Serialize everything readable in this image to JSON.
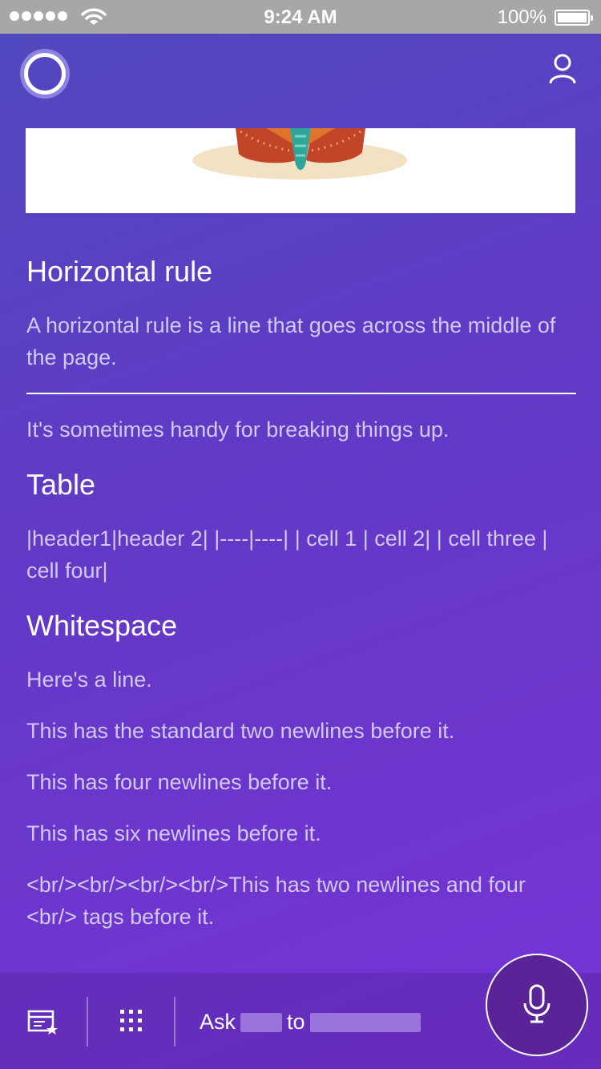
{
  "status_bar": {
    "time": "9:24 AM",
    "battery": "100%"
  },
  "icons": {
    "cortana": "cortana-ring-icon",
    "profile": "person-icon",
    "notebook": "notebook-star-icon",
    "apps": "grid-icon",
    "mic": "microphone-icon"
  },
  "colors": {
    "accent": "#6a3bd0",
    "status_bar": "#a7a7a7"
  },
  "sections": {
    "horizontal_rule": {
      "title": "Horizontal rule",
      "body": "A horizontal rule is a line that goes across the middle of the page.",
      "after": "It's sometimes handy for breaking things up."
    },
    "table": {
      "title": "Table",
      "body": "|header1|header 2| |----|----| | cell 1 | cell 2| | cell three | cell four|"
    },
    "whitespace": {
      "title": "Whitespace",
      "lines": [
        "Here's a line.",
        "This has the standard two newlines before it.",
        "This has four newlines before it.",
        "This has six newlines before it.",
        "<br/><br/><br/><br/>This has two newlines and four <br/> tags before it."
      ]
    }
  },
  "bottom_bar": {
    "ask_label": "Ask",
    "to_label": "to"
  }
}
